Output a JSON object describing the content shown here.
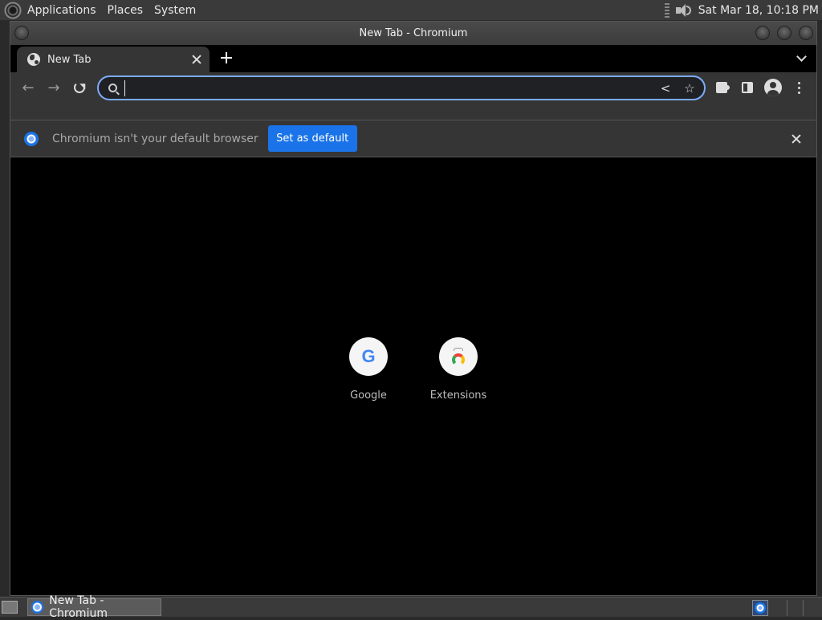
{
  "top_panel": {
    "menus": [
      "Applications",
      "Places",
      "System"
    ],
    "clock": "Sat Mar 18, 10:18 PM"
  },
  "window": {
    "title": "New Tab - Chromium"
  },
  "tabs": [
    {
      "label": "New Tab",
      "active": true
    }
  ],
  "omnibox": {
    "value": "",
    "placeholder": ""
  },
  "infobar": {
    "message": "Chromium isn't your default browser",
    "button_label": "Set as default"
  },
  "shortcuts": [
    {
      "label": "Google",
      "icon": "google-g-icon"
    },
    {
      "label": "Extensions",
      "icon": "chrome-web-store-icon"
    }
  ],
  "taskbar": {
    "window_label": "New Tab - Chromium"
  },
  "colors": {
    "accent": "#1a73e8",
    "focus_ring": "#7cacf8",
    "toolbar": "#353535"
  }
}
